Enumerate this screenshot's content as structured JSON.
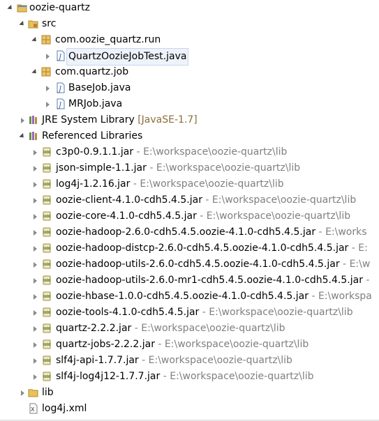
{
  "project": {
    "name": "oozie-quartz"
  },
  "src": {
    "name": "src",
    "packages": [
      {
        "name": "com.oozie_quartz.run",
        "files": [
          "QuartzOozieJobTest.java"
        ]
      },
      {
        "name": "com.quartz.job",
        "files": [
          "BaseJob.java",
          "MRJob.java"
        ]
      }
    ]
  },
  "jre": {
    "name": "JRE System Library",
    "decoration": "[JavaSE-1.7]"
  },
  "libraries": {
    "name": "Referenced Libraries",
    "separator": " - ",
    "items": [
      {
        "jar": "c3p0-0.9.1.1.jar",
        "path": "E:\\workspace\\oozie-quartz\\lib"
      },
      {
        "jar": "json-simple-1.1.jar",
        "path": "E:\\workspace\\oozie-quartz\\lib"
      },
      {
        "jar": "log4j-1.2.16.jar",
        "path": "E:\\workspace\\oozie-quartz\\lib"
      },
      {
        "jar": "oozie-client-4.1.0-cdh5.4.5.jar",
        "path": "E:\\workspace\\oozie-quartz\\lib"
      },
      {
        "jar": "oozie-core-4.1.0-cdh5.4.5.jar",
        "path": "E:\\workspace\\oozie-quartz\\lib"
      },
      {
        "jar": "oozie-hadoop-2.6.0-cdh5.4.5.oozie-4.1.0-cdh5.4.5.jar",
        "path": "E:\\works"
      },
      {
        "jar": "oozie-hadoop-distcp-2.6.0-cdh5.4.5.oozie-4.1.0-cdh5.4.5.jar",
        "path": "E:"
      },
      {
        "jar": "oozie-hadoop-utils-2.6.0-cdh5.4.5.oozie-4.1.0-cdh5.4.5.jar",
        "path": "E:\\w"
      },
      {
        "jar": "oozie-hadoop-utils-2.6.0-mr1-cdh5.4.5.oozie-4.1.0-cdh5.4.5.jar",
        "path": ""
      },
      {
        "jar": "oozie-hbase-1.0.0-cdh5.4.5.oozie-4.1.0-cdh5.4.5.jar",
        "path": "E:\\workspa"
      },
      {
        "jar": "oozie-tools-4.1.0-cdh5.4.5.jar",
        "path": "E:\\workspace\\oozie-quartz\\lib"
      },
      {
        "jar": "quartz-2.2.2.jar",
        "path": "E:\\workspace\\oozie-quartz\\lib"
      },
      {
        "jar": "quartz-jobs-2.2.2.jar",
        "path": "E:\\workspace\\oozie-quartz\\lib"
      },
      {
        "jar": "slf4j-api-1.7.7.jar",
        "path": "E:\\workspace\\oozie-quartz\\lib"
      },
      {
        "jar": "slf4j-log4j12-1.7.7.jar",
        "path": "E:\\workspace\\oozie-quartz\\lib"
      }
    ]
  },
  "lib_folder": {
    "name": "lib"
  },
  "log4j_xml": {
    "name": "log4j.xml"
  },
  "colors": {
    "folder": "#e8c25a",
    "package": "#b8860b",
    "java_file": "#5a7fb5",
    "jar": "#6b8e4e",
    "decoration": "#8a6d3b",
    "path": "#7f7f7f"
  }
}
